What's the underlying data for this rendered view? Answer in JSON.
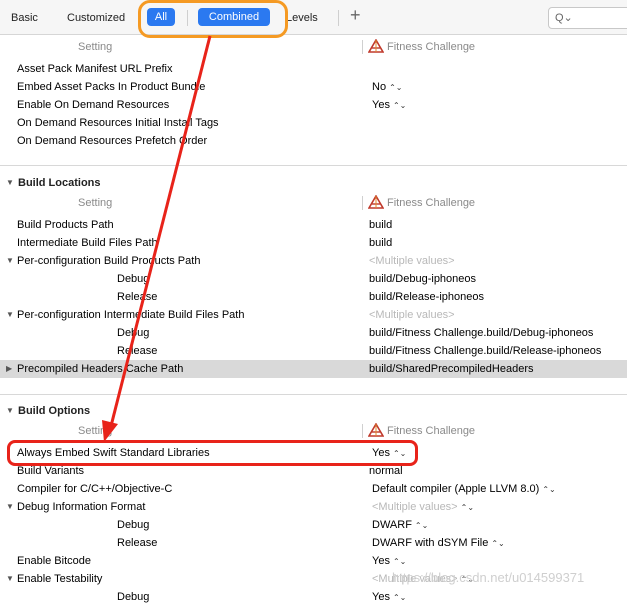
{
  "toolbar": {
    "basic": "Basic",
    "customized": "Customized",
    "all": "All",
    "combined": "Combined",
    "levels": "Levels",
    "plus": "+",
    "search_icon": "Q⌄"
  },
  "columns": {
    "setting": "Setting",
    "target": "Fitness Challenge"
  },
  "top_rows": [
    {
      "name": "Asset Pack Manifest URL Prefix",
      "value": ""
    },
    {
      "name": "Embed Asset Packs In Product Bundle",
      "value": "No"
    },
    {
      "name": "Enable On Demand Resources",
      "value": "Yes"
    },
    {
      "name": "On Demand Resources Initial Install Tags",
      "value": ""
    },
    {
      "name": "On Demand Resources Prefetch Order",
      "value": ""
    }
  ],
  "build_locations": {
    "title": "Build Locations",
    "rows": [
      {
        "name": "Build Products Path",
        "value": "build"
      },
      {
        "name": "Intermediate Build Files Path",
        "value": "build"
      },
      {
        "name": "Per-configuration Build Products Path",
        "value": "<Multiple values>"
      },
      {
        "name": "Debug",
        "value": "build/Debug-iphoneos"
      },
      {
        "name": "Release",
        "value": "build/Release-iphoneos"
      },
      {
        "name": "Per-configuration Intermediate Build Files Path",
        "value": "<Multiple values>"
      },
      {
        "name": "Debug",
        "value": "build/Fitness Challenge.build/Debug-iphoneos"
      },
      {
        "name": "Release",
        "value": "build/Fitness Challenge.build/Release-iphoneos"
      },
      {
        "name": "Precompiled Headers Cache Path",
        "value": "build/SharedPrecompiledHeaders"
      }
    ]
  },
  "build_options": {
    "title": "Build Options",
    "rows": [
      {
        "name": "Always Embed Swift Standard Libraries",
        "value": "Yes"
      },
      {
        "name": "Build Variants",
        "value": "normal"
      },
      {
        "name": "Compiler for C/C++/Objective-C",
        "value": "Default compiler (Apple LLVM 8.0)"
      },
      {
        "name": "Debug Information Format",
        "value": "<Multiple values>"
      },
      {
        "name": "Debug",
        "value": "DWARF"
      },
      {
        "name": "Release",
        "value": "DWARF with dSYM File"
      },
      {
        "name": "Enable Bitcode",
        "value": "Yes"
      },
      {
        "name": "Enable Testability",
        "value": "<Multiple values>"
      },
      {
        "name": "Debug",
        "value": "Yes"
      }
    ]
  },
  "watermark": "https://blog.csdn.net/u014599371",
  "colors": {
    "accent": "#2b79f0",
    "highlight_orange": "#f59a23",
    "highlight_red": "#e8231a"
  }
}
